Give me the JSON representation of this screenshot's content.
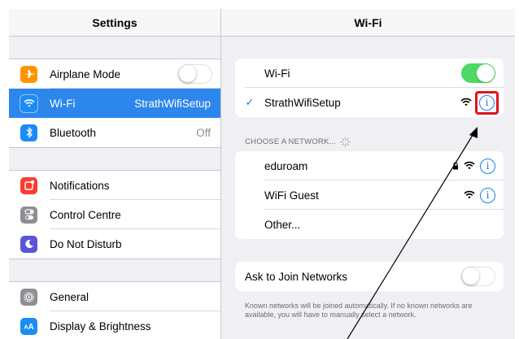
{
  "colors": {
    "accent": "#1a7cf5",
    "selected_row": "#2c86eb",
    "toggle_on": "#4cd964",
    "annotation": "#e4111b"
  },
  "left": {
    "title": "Settings",
    "groups": [
      [
        {
          "label": "Airplane Mode",
          "icon": "airplane-icon",
          "icon_color": "#fe9500",
          "control": "toggle-off"
        },
        {
          "label": "Wi-Fi",
          "icon": "wifi-icon",
          "icon_color": "#1b8cf5",
          "value": "StrathWifiSetup",
          "selected": true
        },
        {
          "label": "Bluetooth",
          "icon": "bluetooth-icon",
          "icon_color": "#1b8cf5",
          "value": "Off"
        }
      ],
      [
        {
          "label": "Notifications",
          "icon": "notifications-icon",
          "icon_color": "#fd3b30"
        },
        {
          "label": "Control Centre",
          "icon": "control-centre-icon",
          "icon_color": "#8e8e93"
        },
        {
          "label": "Do Not Disturb",
          "icon": "moon-icon",
          "icon_color": "#5856d6"
        }
      ],
      [
        {
          "label": "General",
          "icon": "gear-icon",
          "icon_color": "#8e8e93"
        },
        {
          "label": "Display & Brightness",
          "icon": "display-brightness-icon",
          "icon_color": "#1b8cf5"
        }
      ]
    ]
  },
  "right": {
    "title": "Wi-Fi",
    "wifi_toggle_label": "Wi-Fi",
    "wifi_on": true,
    "connected_network": "StrathWifiSetup",
    "choose_header": "CHOOSE A NETWORK...",
    "networks": [
      {
        "name": "eduroam",
        "secured": true
      },
      {
        "name": "WiFi Guest",
        "secured": false
      }
    ],
    "other_label": "Other...",
    "ask_label": "Ask to Join Networks",
    "ask_on": false,
    "footer": "Known networks will be joined automatically. If no known networks are available, you will have to manually select a network."
  }
}
